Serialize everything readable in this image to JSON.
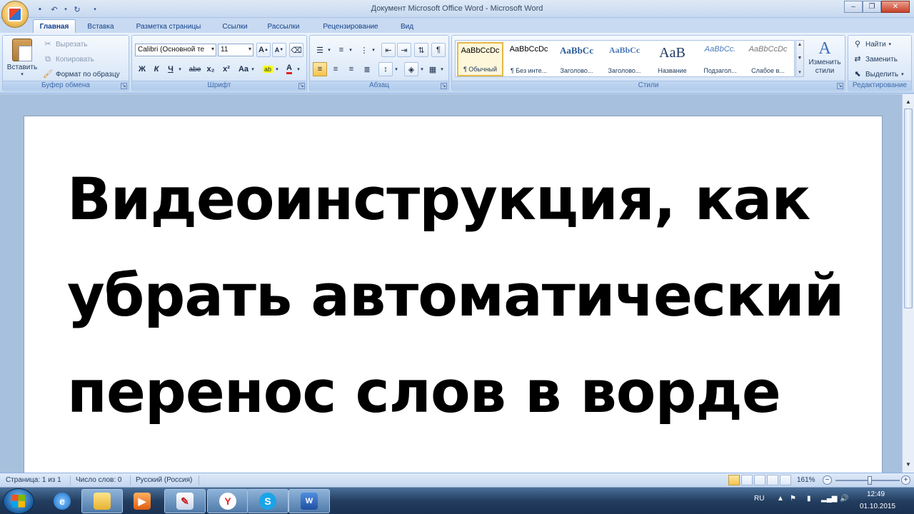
{
  "window": {
    "title": "Документ Microsoft Office Word - Microsoft Word",
    "minimize": "–",
    "restore": "❐",
    "close": "✕"
  },
  "tabs": [
    {
      "label": "Главная",
      "active": true
    },
    {
      "label": "Вставка"
    },
    {
      "label": "Разметка страницы"
    },
    {
      "label": "Ссылки"
    },
    {
      "label": "Рассылки"
    },
    {
      "label": "Рецензирование"
    },
    {
      "label": "Вид"
    }
  ],
  "clipboard": {
    "paste_label": "Вставить",
    "cut_label": "Вырезать",
    "copy_label": "Копировать",
    "format_painter_label": "Формат по образцу",
    "group_label": "Буфер обмена"
  },
  "font": {
    "font_name": "Calibri (Основной те",
    "font_size": "11",
    "group_label": "Шрифт",
    "bold": "Ж",
    "italic": "К",
    "underline": "Ч",
    "strike": "abe",
    "subscript": "x₂",
    "superscript": "x²",
    "case": "Aa",
    "grow": "A",
    "shrink": "A"
  },
  "paragraph": {
    "group_label": "Абзац"
  },
  "styles": {
    "group_label": "Стили",
    "items": [
      {
        "sample": "AaBbCcDc",
        "name": "¶ Обычный",
        "selected": true
      },
      {
        "sample": "AaBbCcDc",
        "name": "¶ Без инте..."
      },
      {
        "sample": "AaBbCc",
        "name": "Заголово..."
      },
      {
        "sample": "AaBbCc",
        "name": "Заголово..."
      },
      {
        "sample": "AaB",
        "name": "Название"
      },
      {
        "sample": "AaBbCc.",
        "name": "Подзагол..."
      },
      {
        "sample": "AaBbCcDc",
        "name": "Слабое в..."
      }
    ],
    "change_styles_label": "Изменить стили"
  },
  "editing": {
    "group_label": "Редактирование",
    "find_label": "Найти",
    "replace_label": "Заменить",
    "select_label": "Выделить"
  },
  "document": {
    "text": "Видеоинструкция, как убрать автоматический перенос слов в ворде"
  },
  "status": {
    "page": "Страница: 1 из 1",
    "words": "Число слов: 0",
    "language": "Русский (Россия)",
    "zoom": "161%"
  },
  "taskbar": {
    "lang": "RU",
    "time": "12:49",
    "date": "01.10.2015"
  },
  "colors": {
    "ribbon_accent": "#15428b",
    "highlight_selected": "#f6c349"
  }
}
